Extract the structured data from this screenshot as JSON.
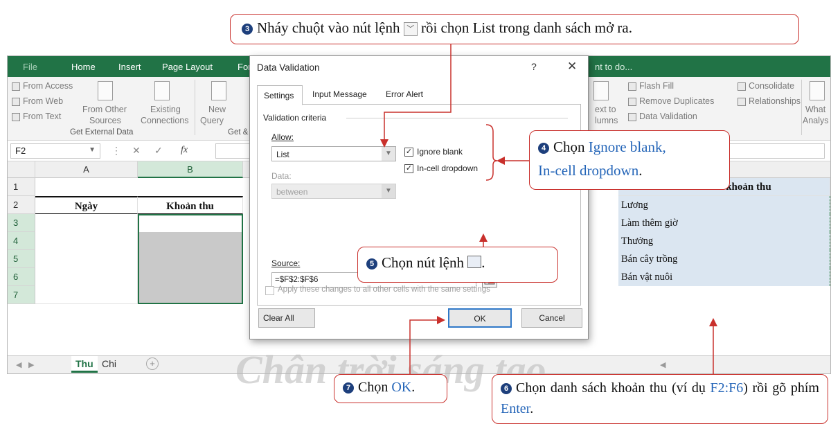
{
  "excel": {
    "tabs": [
      "File",
      "Home",
      "Insert",
      "Page Layout",
      "For"
    ],
    "tell_me": "nt to do...",
    "ribbon": {
      "from_access": "From Access",
      "from_web": "From Web",
      "from_text": "From Text",
      "from_other_1": "From Other",
      "from_other_2": "Sources",
      "existing_1": "Existing",
      "existing_2": "Connections",
      "new_1": "New",
      "new_2": "Query",
      "group_external": "Get External Data",
      "group_get": "Get &",
      "ext_to_1": "ext to",
      "ext_to_2": "lumns",
      "flash_fill": "Flash Fill",
      "remove_dup": "Remove Duplicates",
      "data_validation": "Data Validation",
      "consolidate": "Consolidate",
      "relationships": "Relationships",
      "what_1": "What",
      "what_2": "Analys"
    },
    "name_box": "F2",
    "fx": "fx",
    "columns": [
      "A",
      "B"
    ],
    "rows": [
      "1",
      "2",
      "3",
      "4",
      "5",
      "6",
      "7"
    ],
    "header_ngay": "Ngày",
    "header_khoan_thu": "Khoản thu",
    "list_header": "Danh sách khoản thu",
    "list_items": [
      "Lương",
      "Làm thêm giờ",
      "Thưởng",
      "Bán cây trồng",
      "Bán vật nuôi"
    ],
    "sheet_tabs": [
      "Thu",
      "Chi"
    ]
  },
  "dialog": {
    "title": "Data Validation",
    "help": "?",
    "close": "✕",
    "tabs": [
      "Settings",
      "Input Message",
      "Error Alert"
    ],
    "validation_criteria": "Validation criteria",
    "allow_label": "Allow:",
    "allow_value": "List",
    "data_label": "Data:",
    "data_value": "between",
    "ignore_blank": "Ignore blank",
    "in_cell_dropdown": "In-cell dropdown",
    "source_label": "Source:",
    "source_value": "=$F$2:$F$6",
    "apply_all": "Apply these changes to all other cells with the same settings",
    "clear_all": "Clear All",
    "ok": "OK",
    "cancel": "Cancel"
  },
  "callouts": {
    "step3_num": "3",
    "step3_a": "Nháy chuột vào nút lệnh",
    "step3_b": "rồi chọn List trong danh sách mở ra.",
    "step4_num": "4",
    "step4_a": "Chọn",
    "step4_b": "Ignore blank,",
    "step4_c": "In-cell dropdown",
    "step4_d": ".",
    "step5_num": "5",
    "step5_a": "Chọn nút lệnh",
    "step5_b": ".",
    "step6_num": "6",
    "step6_a": "Chọn danh sách khoản thu (ví dụ",
    "step6_b": "F2:F6",
    "step6_c": ") rồi gõ phím",
    "step6_d": "Enter",
    "step6_e": ".",
    "step7_num": "7",
    "step7_a": "Chọn",
    "step7_b": "OK",
    "step7_c": "."
  },
  "watermark": "Chân trời sáng tạo",
  "colors": {
    "excel_green": "#217346",
    "callout_red": "#c9302c",
    "accent_blue": "#2465b8",
    "list_fill": "#dbe6f1"
  }
}
